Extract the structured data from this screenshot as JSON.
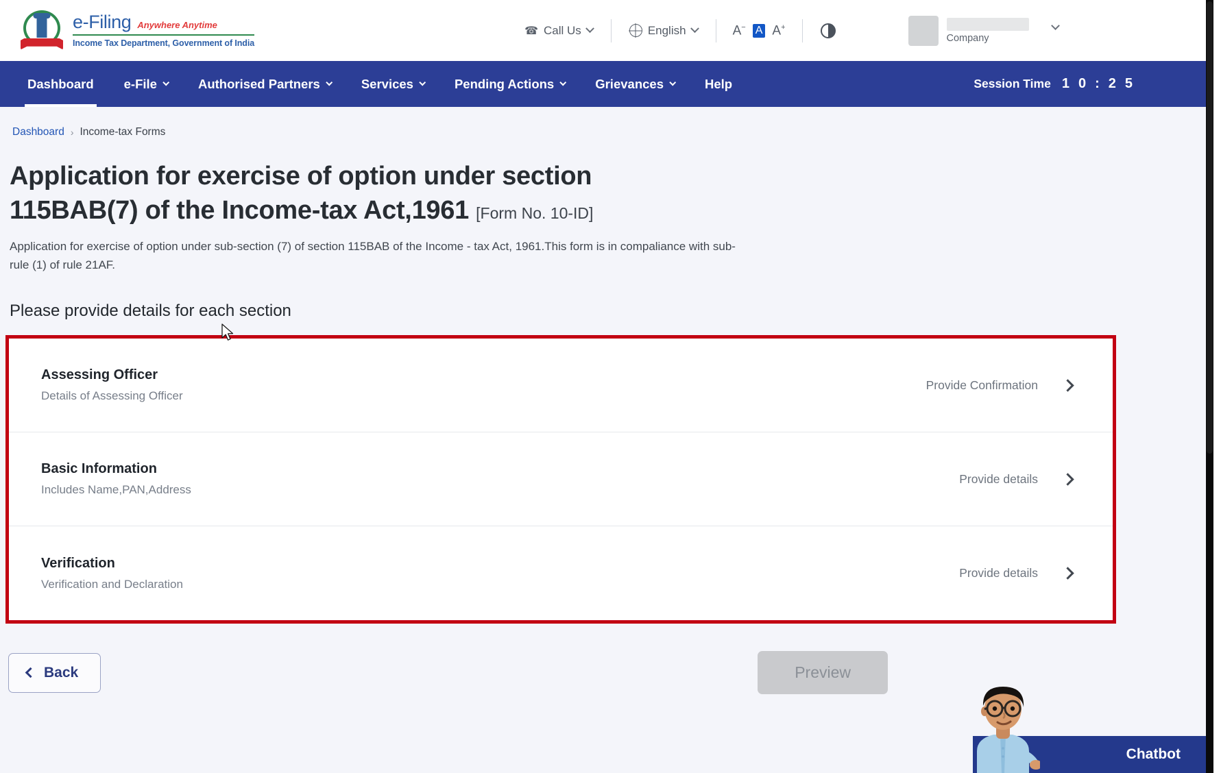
{
  "header": {
    "brand": {
      "main": "e-Filing",
      "tagline": "Anywhere Anytime",
      "sub": "Income Tax Department, Government of India",
      "emblem_icon": "india-emblem-icon"
    },
    "tools": {
      "call_us": "Call Us",
      "call_icon": "phone-icon",
      "language": "English",
      "language_icon": "globe-icon",
      "font_decrease": "A",
      "font_normal": "A",
      "font_increase": "A",
      "contrast_icon": "contrast-icon",
      "caret_icon": "chevron-down-icon"
    },
    "user": {
      "name": "",
      "role": "Company",
      "caret_icon": "chevron-down-icon",
      "avatar_icon": "avatar"
    }
  },
  "nav": {
    "items": [
      {
        "label": "Dashboard",
        "has_caret": false,
        "active": true
      },
      {
        "label": "e-File",
        "has_caret": true,
        "active": false
      },
      {
        "label": "Authorised Partners",
        "has_caret": true,
        "active": false
      },
      {
        "label": "Services",
        "has_caret": true,
        "active": false
      },
      {
        "label": "Pending Actions",
        "has_caret": true,
        "active": false
      },
      {
        "label": "Grievances",
        "has_caret": true,
        "active": false
      },
      {
        "label": "Help",
        "has_caret": false,
        "active": false
      }
    ],
    "session": {
      "label": "Session Time",
      "digits": [
        "1",
        "0",
        ":",
        "2",
        "5"
      ]
    },
    "bg_color": "#2c3e96"
  },
  "breadcrumb": {
    "root": "Dashboard",
    "separator": "›",
    "current": "Income-tax Forms"
  },
  "page": {
    "title": "Application for exercise of option under section 115BAB(7) of the Income-tax Act,1961",
    "form_no": "[Form No. 10-ID]",
    "description": "Application for exercise of option under sub-section (7) of section 115BAB of the Income - tax Act, 1961.This form is in compaliance with sub-rule (1) of rule 21AF.",
    "section_prompt": "Please provide details for each section"
  },
  "sections": {
    "highlight_color": "#c20012",
    "rows": [
      {
        "title": "Assessing Officer",
        "subtitle": "Details of Assessing Officer",
        "action": "Provide Confirmation",
        "chevron_icon": "chevron-right-icon"
      },
      {
        "title": "Basic Information",
        "subtitle": "Includes Name,PAN,Address",
        "action": "Provide details",
        "chevron_icon": "chevron-right-icon"
      },
      {
        "title": "Verification",
        "subtitle": "Verification and Declaration",
        "action": "Provide details",
        "chevron_icon": "chevron-right-icon"
      }
    ]
  },
  "footer": {
    "back_label": "Back",
    "back_icon": "chevron-left-icon",
    "preview_label": "Preview",
    "preview_disabled": true
  },
  "chatbot": {
    "label": "Chatbot",
    "avatar_icon": "chatbot-avatar-icon",
    "bar_color": "#24398c"
  }
}
